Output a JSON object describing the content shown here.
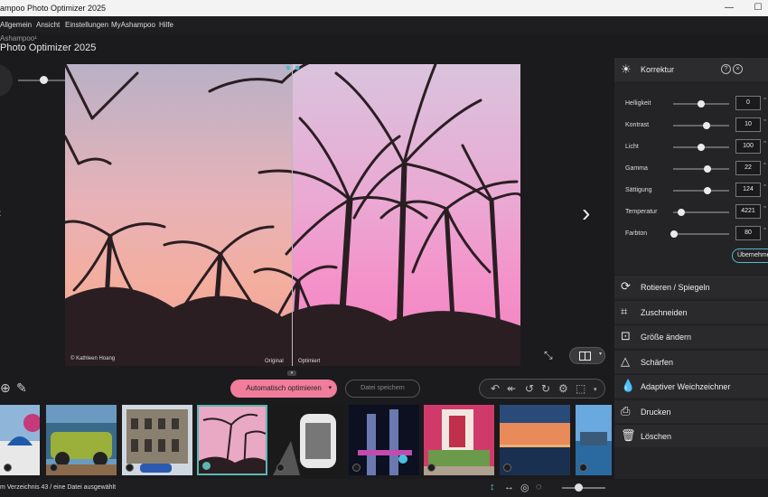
{
  "window": {
    "title": "ampoo Photo Optimizer 2025",
    "minimize_icon": "minimize-icon",
    "maximize_icon": "maximize-icon"
  },
  "menu": {
    "items": [
      "Allgemein",
      "Ansicht",
      "Einstellungen",
      "MyAshampoo",
      "Hilfe"
    ]
  },
  "brand": {
    "small": "Ashampoo¹",
    "big": "Photo Optimizer 2025"
  },
  "viewer": {
    "label_original": "Original",
    "label_optimized": "Optimiert",
    "credit": "© Kathleen Hoang",
    "zoom_level": 0.35
  },
  "toolbar": {
    "auto_optimize": "Automatisch optimieren",
    "save_file": "Datei speichern"
  },
  "filmstrip": {
    "selected_index": 3,
    "count": 8
  },
  "status": {
    "text": "m Verzeichnis 43 / eine Datei ausgewählt",
    "zoom": 0.33
  },
  "panel": {
    "title": "Korrektur",
    "apply_label": "Übernehmen",
    "adjustments": [
      {
        "label": "Helligkeit",
        "value": "0",
        "pos": 0.5
      },
      {
        "label": "Kontrast",
        "value": "10",
        "pos": 0.6
      },
      {
        "label": "Licht",
        "value": "100",
        "pos": 0.5
      },
      {
        "label": "Gamma",
        "value": "22",
        "pos": 0.61
      },
      {
        "label": "Sättigung",
        "value": "124",
        "pos": 0.62
      },
      {
        "label": "Temperatur",
        "value": "4221",
        "pos": 0.15
      },
      {
        "label": "Farbton",
        "value": "80",
        "pos": 0.02
      }
    ],
    "tools": [
      {
        "label": "Rotieren / Spiegeln",
        "icon": "rotate-icon"
      },
      {
        "label": "Zuschneiden",
        "icon": "crop-icon"
      },
      {
        "label": "Größe ändern",
        "icon": "resize-icon"
      },
      {
        "label": "Schärfen",
        "icon": "sharpen-icon"
      },
      {
        "label": "Adaptiver Weichzeichner",
        "icon": "blur-icon"
      },
      {
        "label": "Drucken",
        "icon": "print-icon"
      },
      {
        "label": "Löschen",
        "icon": "delete-icon"
      }
    ]
  }
}
